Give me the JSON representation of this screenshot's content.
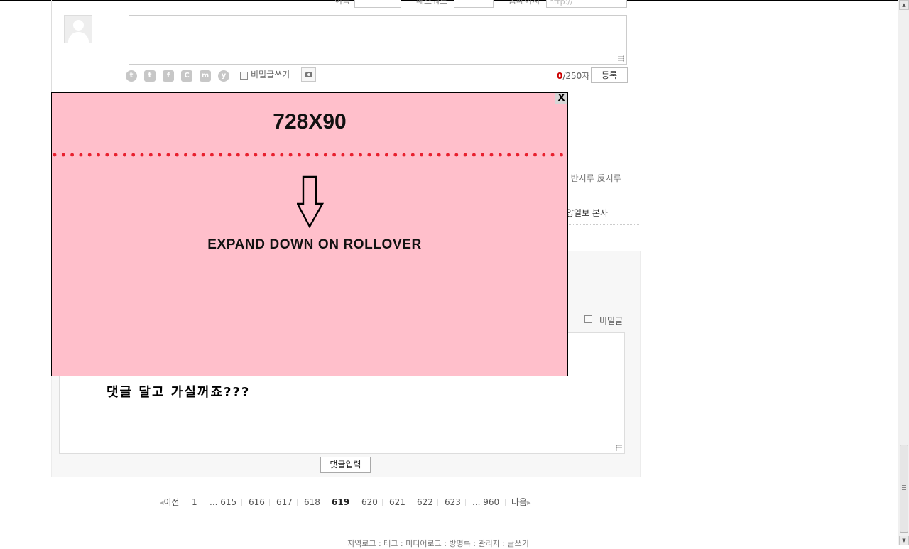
{
  "comment_form": {
    "name_label": "이름",
    "password_label": "패스워드",
    "homepage_label": "홈페이지",
    "homepage_placeholder": "http://",
    "secret_label": "비밀글쓰기",
    "char_count_current": "0",
    "char_count_max": "/250자",
    "submit_label": "등록",
    "share_icons": [
      "tistory-icon",
      "twitter-icon",
      "facebook-icon",
      "cyworld-icon",
      "me2day-icon",
      "yozm-icon"
    ]
  },
  "background_text": {
    "tags": "반지루 反지루",
    "post_title": "양일보 본사"
  },
  "guestbook": {
    "secret_label": "비밀글",
    "message": "댓글 달고 가실꺼죠???",
    "submit_label": "댓글입력"
  },
  "pagination": {
    "prev_label": "이전",
    "next_label": "다음",
    "pages": [
      {
        "label": "1",
        "current": false
      },
      {
        "label": "... 615",
        "current": false
      },
      {
        "label": "616",
        "current": false
      },
      {
        "label": "617",
        "current": false
      },
      {
        "label": "618",
        "current": false
      },
      {
        "label": "619",
        "current": true
      },
      {
        "label": "620",
        "current": false
      },
      {
        "label": "621",
        "current": false
      },
      {
        "label": "622",
        "current": false
      },
      {
        "label": "623",
        "current": false
      },
      {
        "label": "... 960",
        "current": false
      }
    ]
  },
  "footer": {
    "links": "지역로그 : 태그 : 미디어로그 : 방명록 : 관리자 : 글쓰기"
  },
  "ad": {
    "close_label": "X",
    "title": "728X90",
    "caption": "EXPAND DOWN ON ROLLOVER",
    "background_color": "#ffbfcb",
    "dot_color": "#e8202e"
  }
}
